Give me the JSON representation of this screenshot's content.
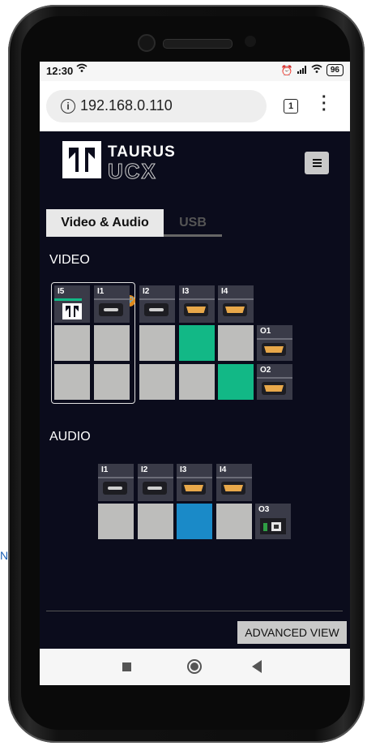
{
  "page": {
    "side_letter": "N"
  },
  "status_bar": {
    "time": "12:30",
    "battery": "96"
  },
  "browser": {
    "url": "192.168.0.110",
    "tab_count": "1"
  },
  "brand": {
    "name_line1": "TAURUS",
    "name_line2": "UCX"
  },
  "tabs": [
    {
      "label": "Video & Audio",
      "active": true
    },
    {
      "label": "USB",
      "active": false
    }
  ],
  "video": {
    "title": "VIDEO",
    "inputs": [
      {
        "label": "I5",
        "port": "taurus-logo"
      },
      {
        "label": "I1",
        "port": "usb-c"
      },
      {
        "label": "I2",
        "port": "usb-c"
      },
      {
        "label": "I3",
        "port": "hdmi"
      },
      {
        "label": "I4",
        "port": "hdmi"
      }
    ],
    "outputs": [
      {
        "label": "O1",
        "port": "hdmi",
        "routed_input": "I3"
      },
      {
        "label": "O2",
        "port": "hdmi",
        "routed_input": "I4"
      }
    ]
  },
  "audio": {
    "title": "AUDIO",
    "inputs": [
      {
        "label": "I1",
        "port": "usb-c"
      },
      {
        "label": "I2",
        "port": "usb-c"
      },
      {
        "label": "I3",
        "port": "hdmi"
      },
      {
        "label": "I4",
        "port": "hdmi"
      }
    ],
    "outputs": [
      {
        "label": "O3",
        "port": "dante",
        "routed_input": "I3"
      }
    ]
  },
  "buttons": {
    "advanced_view": "ADVANCED VIEW"
  },
  "colors": {
    "video_active": "#12b886",
    "audio_active": "#1a8ac8",
    "background": "#0b0c1c",
    "link": "#e08a1e"
  }
}
